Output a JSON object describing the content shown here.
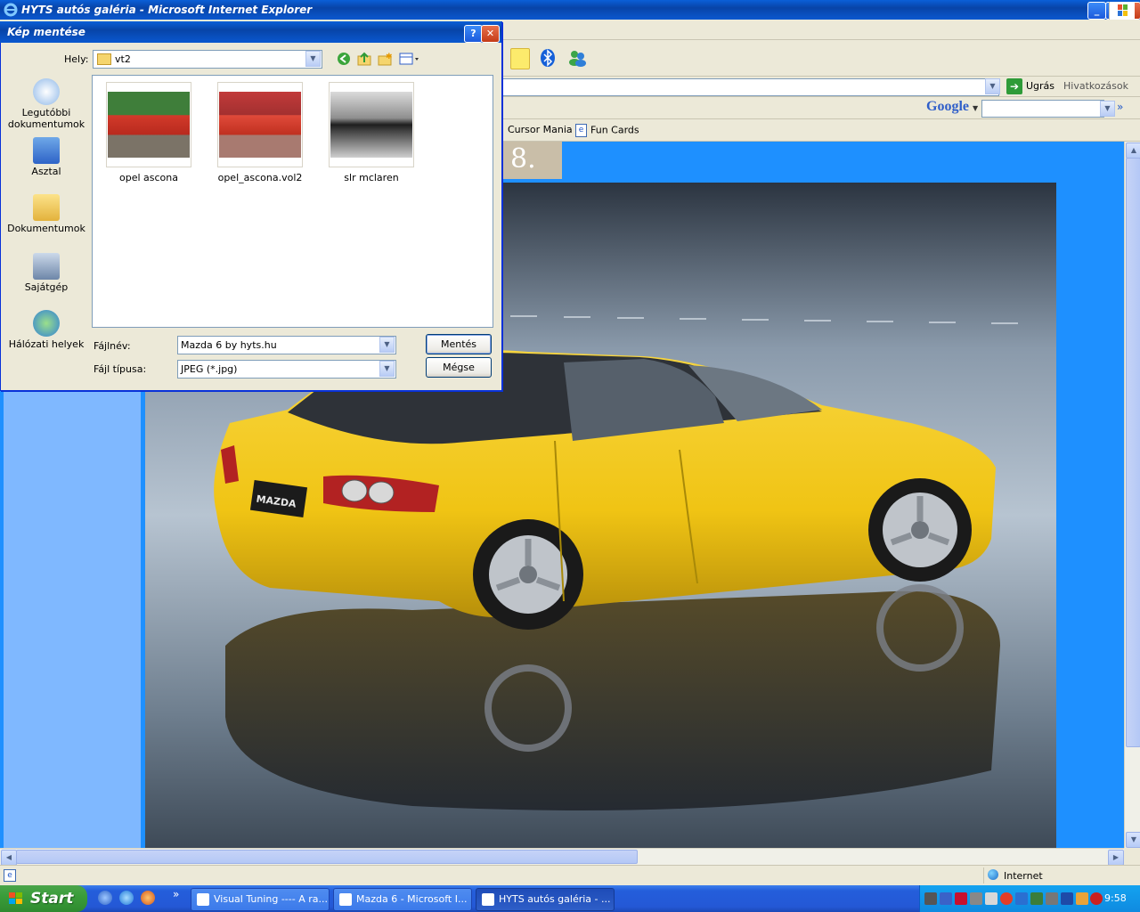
{
  "browser": {
    "title": "HYTS autós galéria - Microsoft Internet Explorer",
    "go_label": "Ugrás",
    "links_label": "Hivatkozások",
    "google_label": "Google",
    "links": [
      {
        "label": "Cursor Mania",
        "icon": "page-icon"
      },
      {
        "label": "Fun Cards",
        "icon": "ie-page-icon"
      }
    ],
    "status_zone": "Internet"
  },
  "content": {
    "number_tile": "8.",
    "photo_badge": "MAZDA",
    "colors": {
      "background": "#1E90FF",
      "car": "#F2C518"
    }
  },
  "dialog": {
    "title": "Kép mentése",
    "location_label": "Hely:",
    "location_value": "vt2",
    "places": [
      {
        "label": "Legutóbbi dokumentumok",
        "icon": "recent-documents-icon"
      },
      {
        "label": "Asztal",
        "icon": "desktop-icon"
      },
      {
        "label": "Dokumentumok",
        "icon": "my-documents-icon"
      },
      {
        "label": "Sajátgép",
        "icon": "my-computer-icon"
      },
      {
        "label": "Hálózati helyek",
        "icon": "network-places-icon"
      }
    ],
    "files": [
      {
        "name": "opel ascona"
      },
      {
        "name": "opel_ascona.vol2"
      },
      {
        "name": "slr mclaren"
      }
    ],
    "filename_label": "Fájlnév:",
    "filename_value": "Mazda 6 by hyts.hu",
    "filetype_label": "Fájl típusa:",
    "filetype_value": "JPEG (*.jpg)",
    "save_label": "Mentés",
    "cancel_label": "Mégse"
  },
  "taskbar": {
    "start_label": "Start",
    "buttons": [
      {
        "label": "Visual Tuning ---- A ra..."
      },
      {
        "label": "Mazda 6 - Microsoft I..."
      },
      {
        "label": "HYTS autós galéria - ..."
      }
    ],
    "overflow": "»",
    "clock": "9:58"
  }
}
